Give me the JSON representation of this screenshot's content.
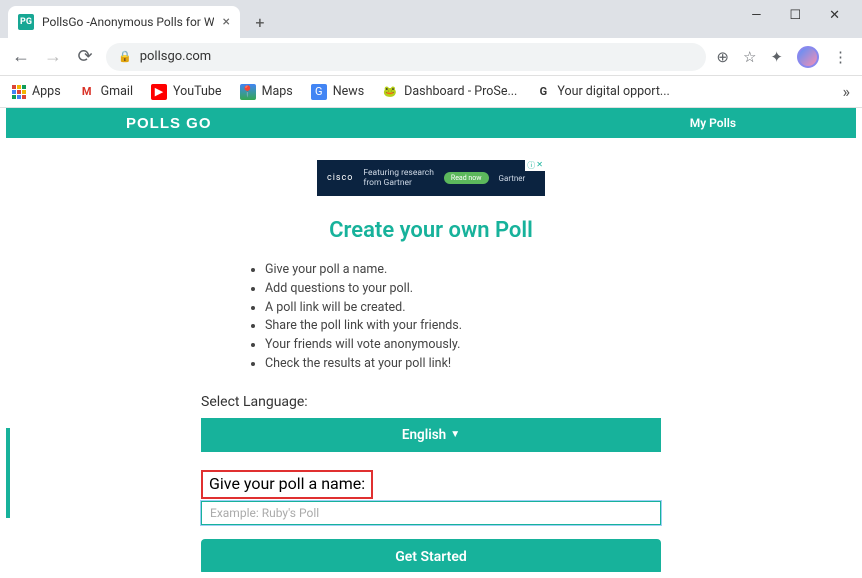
{
  "window": {
    "tab_title": "PollsGo -Anonymous Polls for W",
    "tab_favicon": "PG",
    "url": "pollsgo.com"
  },
  "bookmarks": {
    "apps": "Apps",
    "gmail": "Gmail",
    "youtube": "YouTube",
    "maps": "Maps",
    "news": "News",
    "dashboard": "Dashboard - ProSe...",
    "google": "Your digital opport..."
  },
  "site": {
    "brand": "POLLS GO",
    "mypolls": "My Polls"
  },
  "ad": {
    "cisco": "cisco",
    "line1": "Featuring research",
    "line2": "from Gartner",
    "cta": "Read now",
    "gartner": "Gartner"
  },
  "main": {
    "title": "Create your own Poll",
    "bullets": [
      "Give your poll a name.",
      "Add questions to your poll.",
      "A poll link will be created.",
      "Share the poll link with your friends.",
      "Your friends will vote anonymously.",
      "Check the results at your poll link!"
    ],
    "select_language_label": "Select Language:",
    "language_value": "English",
    "poll_name_label": "Give your poll a name:",
    "poll_name_placeholder": "Example: Ruby's Poll",
    "get_started": "Get Started"
  }
}
